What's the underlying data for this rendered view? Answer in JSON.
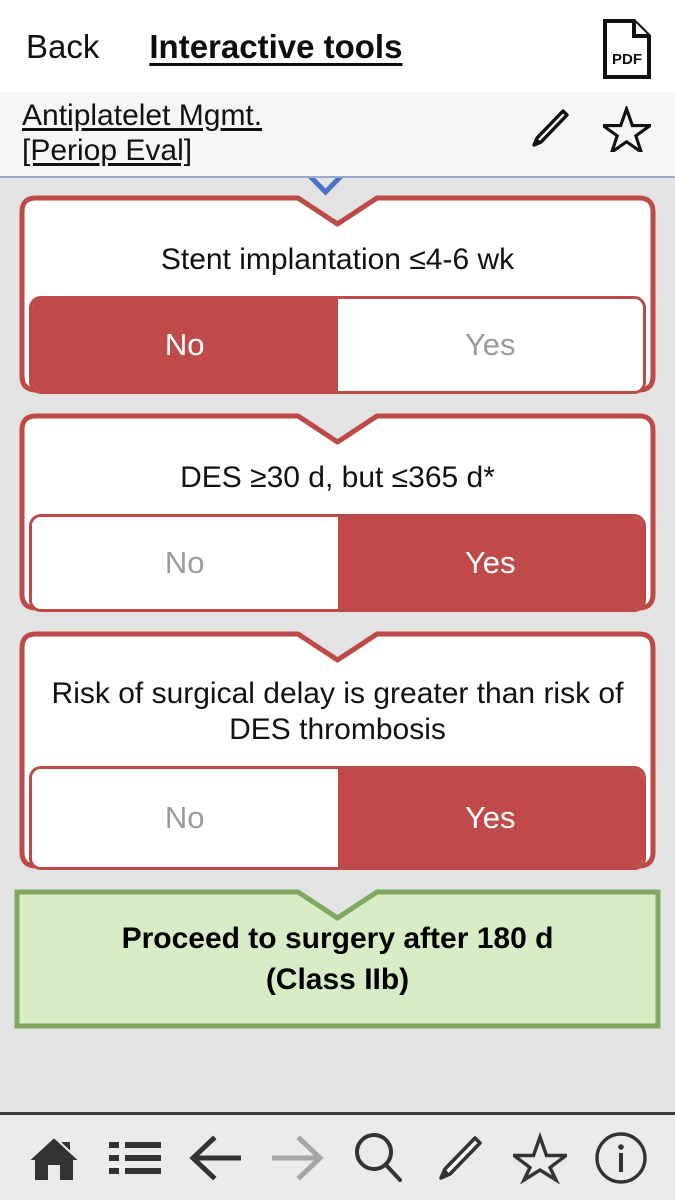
{
  "topbar": {
    "back_label": "Back",
    "title": "Interactive tools",
    "pdf_label": "PDF"
  },
  "subheader": {
    "title_line1": "Antiplatelet Mgmt.",
    "title_line2": "[Periop Eval]",
    "edit_icon": "pencil-icon",
    "favorite_icon": "star-icon"
  },
  "colors": {
    "accent_red": "#c04a49",
    "card_border_red": "#bd4a47",
    "result_green_fill": "#d8edc5",
    "result_green_border": "#7fa860",
    "page_background": "#e3e3e3",
    "toolbar_background": "#ebebeb",
    "unselected_text": "#9b9b9b",
    "top_chevron_blue": "#4a72c8"
  },
  "flow": {
    "steps": [
      {
        "question": "Stent implantation ≤4-6 wk",
        "options": [
          "No",
          "Yes"
        ],
        "selected": "No"
      },
      {
        "question": "DES ≥30 d, but ≤365 d*",
        "options": [
          "No",
          "Yes"
        ],
        "selected": "Yes"
      },
      {
        "question": "Risk of surgical delay is greater than risk of DES thrombosis",
        "options": [
          "No",
          "Yes"
        ],
        "selected": "Yes"
      }
    ],
    "result": {
      "line1": "Proceed to surgery after 180 d",
      "line2": "(Class IIb)"
    }
  },
  "toolbar": {
    "items": [
      {
        "name": "home-icon",
        "label": "Home",
        "state": "enabled"
      },
      {
        "name": "list-icon",
        "label": "Index",
        "state": "enabled"
      },
      {
        "name": "arrow-left-icon",
        "label": "Back",
        "state": "enabled"
      },
      {
        "name": "arrow-right-icon",
        "label": "Forward",
        "state": "disabled"
      },
      {
        "name": "search-icon",
        "label": "Search",
        "state": "enabled"
      },
      {
        "name": "pencil-icon",
        "label": "Notes",
        "state": "enabled"
      },
      {
        "name": "star-icon",
        "label": "Favorite",
        "state": "enabled"
      },
      {
        "name": "info-icon",
        "label": "Info",
        "state": "enabled"
      }
    ]
  }
}
